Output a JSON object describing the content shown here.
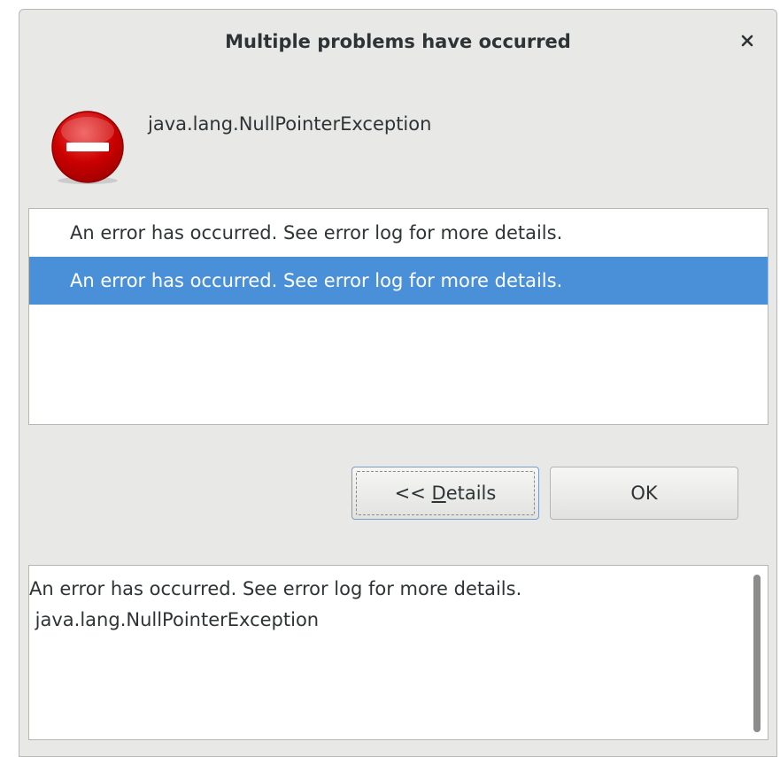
{
  "dialog": {
    "title": "Multiple problems have occurred",
    "close_icon": "close-icon",
    "error_icon": "error-stop-icon",
    "message": "java.lang.NullPointerException"
  },
  "problems": [
    {
      "label": "An error has occurred. See error log for more details.",
      "selected": false
    },
    {
      "label": "An error has occurred. See error log for more details.",
      "selected": true
    }
  ],
  "buttons": {
    "details_prefix": "<< ",
    "details_mnemonic": "D",
    "details_rest": "etails",
    "ok": "OK"
  },
  "details": {
    "line1": "An error has occurred. See error log for more details.",
    "line2": " java.lang.NullPointerException"
  },
  "colors": {
    "selection": "#4a90d9",
    "error_red": "#cc0000",
    "dialog_bg": "#e8e8e7"
  }
}
